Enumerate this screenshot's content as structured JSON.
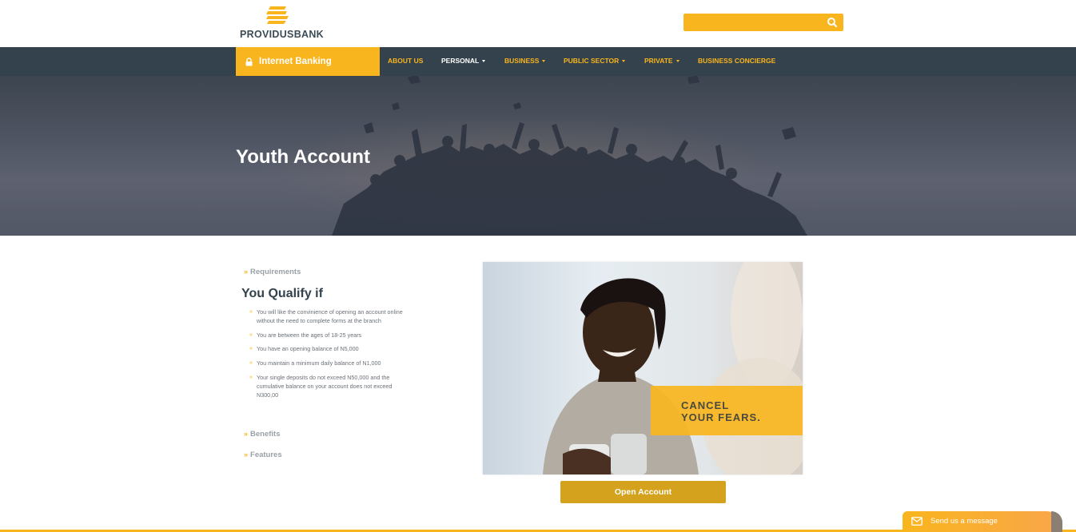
{
  "header": {
    "brand": "PROVIDUSBANK",
    "search_placeholder": "",
    "colors": {
      "accent": "#f9b51e",
      "nav_bg": "#33424c"
    }
  },
  "nav": {
    "internet_banking": "Internet Banking",
    "items": [
      {
        "label": "ABOUT US",
        "dropdown": false
      },
      {
        "label": "PERSONAL",
        "dropdown": true
      },
      {
        "label": "BUSINESS",
        "dropdown": true
      },
      {
        "label": "PUBLIC SECTOR",
        "dropdown": true
      },
      {
        "label": "PRIVATE",
        "dropdown": true
      },
      {
        "label": "BUSINESS CONCIERGE",
        "dropdown": false
      }
    ]
  },
  "hero": {
    "title": "Youth Account"
  },
  "sidebar": {
    "requirements": "Requirements",
    "qualify_title": "You Qualify if",
    "qualify_items": [
      "You will like the convinience of opening an account online without the need to complete forms at the branch",
      "You are between the ages of 18-25 years",
      "You have an opening balance of N5,000",
      "You maintain a minimum daily balance of N1,000",
      "Your single deposits do not exceed N50,000 and the cumulative balance on your account does not exceed N300,00"
    ],
    "benefits": "Benefits",
    "features": "Features"
  },
  "promo": {
    "line1": "CANCEL",
    "line2": "YOUR FEARS."
  },
  "cta": {
    "open_account": "Open Account"
  },
  "chat": {
    "label": "Send us a message"
  }
}
